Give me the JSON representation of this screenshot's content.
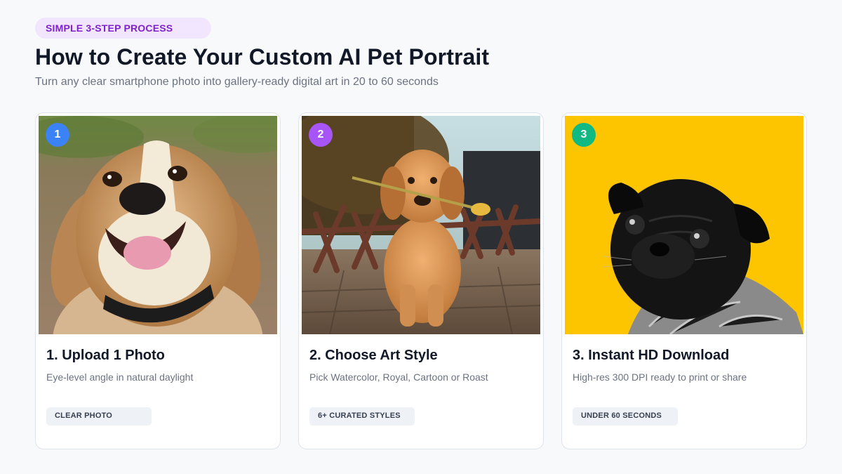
{
  "header": {
    "badge": "SIMPLE 3-STEP PROCESS",
    "title": "How to Create Your Custom AI Pet Portrait",
    "subtitle": "Turn any clear smartphone photo into gallery-ready digital art in 20 to 60 seconds"
  },
  "steps": [
    {
      "number": "1",
      "number_color": "#3b82f6",
      "title": "1. Upload 1 Photo",
      "description": "Eye-level angle in natural daylight",
      "tag": "CLEAR PHOTO",
      "photo_subject": "smiling beagle photo"
    },
    {
      "number": "2",
      "number_color": "#a855f7",
      "title": "2. Choose Art Style",
      "description": "Pick Watercolor, Royal, Cartoon or Roast",
      "tag": "6+ CURATED STYLES",
      "photo_subject": "golden retriever puppy with flower"
    },
    {
      "number": "3",
      "number_color": "#10b981",
      "title": "3. Instant HD Download",
      "description": "High-res 300 DPI ready to print or share",
      "tag": "UNDER 60 SECONDS",
      "photo_subject": "black pug on yellow background"
    }
  ]
}
